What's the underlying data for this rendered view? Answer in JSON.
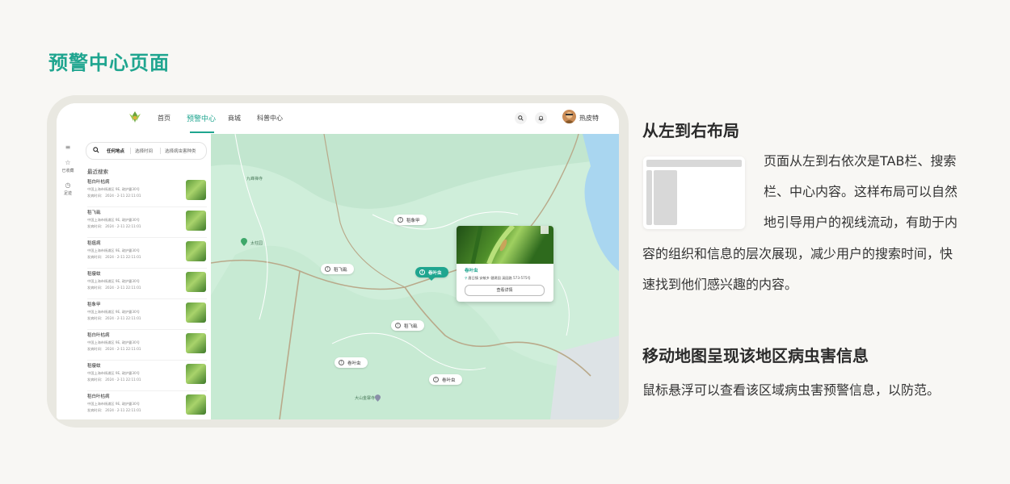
{
  "page_title": "预警中心页面",
  "app": {
    "nav": {
      "home": "首页",
      "warning": "预警中心",
      "mall": "商城",
      "science": "科普中心"
    },
    "user_name": "热皮特",
    "rail": [
      {
        "icon": "menu-icon",
        "label": ""
      },
      {
        "icon": "star-icon",
        "label": "已收藏"
      },
      {
        "icon": "clock-icon",
        "label": "足迹"
      }
    ],
    "search": {
      "location": "任何地点",
      "time": "选择时间",
      "type": "选择病虫害种类"
    },
    "recent_title": "最近搜索",
    "recent_items": [
      {
        "name": "稻白叶枯病",
        "address": "中国上海市杨浦区 9E, 政护豐30号",
        "time": "发病时间：  2024 · 2-11   22:11:01"
      },
      {
        "name": "稻飞虱",
        "address": "中国上海市杨浦区 9E, 政护豐30号",
        "time": "发病时间：  2024 · 2-11   22:11:01"
      },
      {
        "name": "稻瘟病",
        "address": "中国上海市杨浦区 9E, 政护豐30号",
        "time": "发病时间：  2024 · 2-11   22:11:01"
      },
      {
        "name": "稻瘿蚊",
        "address": "中国上海市杨浦区 9E, 政护豐30号",
        "time": "发病时间：  2024 · 2-11   22:11:01"
      },
      {
        "name": "稻象甲",
        "address": "中国上海市杨浦区 9E, 政护豐30号",
        "time": "发病时间：  2024 · 2-11   22:11:01"
      },
      {
        "name": "稻白叶枯病",
        "address": "中国上海市杨浦区 9E, 政护豐30号",
        "time": "发病时间：  2024 · 2-11   22:11:01"
      },
      {
        "name": "稻瘿蚊",
        "address": "中国上海市杨浦区 9E, 政护豐30号",
        "time": "发病时间：  2024 · 2-11   22:11:01"
      },
      {
        "name": "稻白叶枯病",
        "address": "中国上海市杨浦区 9E, 政护豐30号",
        "time": "发病时间：  2024 · 2-11   22:11:01"
      }
    ],
    "map_pins": [
      "稻象甲",
      "稻飞虱",
      "卷叶虫",
      "稻飞虱",
      "卷叶虫",
      "卷叶虫"
    ],
    "map_labels": {
      "temple": "九峰禅寺",
      "peak": "太柱园",
      "mountain": "大山金寨寺"
    },
    "popup": {
      "name": "卷叶虫",
      "location": "唐日镇 安敏乡 健建园 溪园路 573-575号",
      "button": "查看详情"
    }
  },
  "section1": {
    "title": "从左到右布局",
    "lines": [
      "页面从左到右依次是TAB栏、搜索",
      "栏、中心内容。这样布局可以自然",
      "地引导用户的视线流动，有助于内",
      "容的组织和信息的层次展现，减少用户的搜索时间，快",
      "速找到他们感兴趣的内容。"
    ]
  },
  "section2": {
    "title": "移动地图呈现该地区病虫害信息",
    "text": "鼠标悬浮可以查看该区域病虫害预警信息，以防范。"
  },
  "colors": {
    "accent": "#1fa58f",
    "map_bg": "#cfeeda",
    "road": "#b9a98a",
    "water": "#a9d6f0"
  }
}
